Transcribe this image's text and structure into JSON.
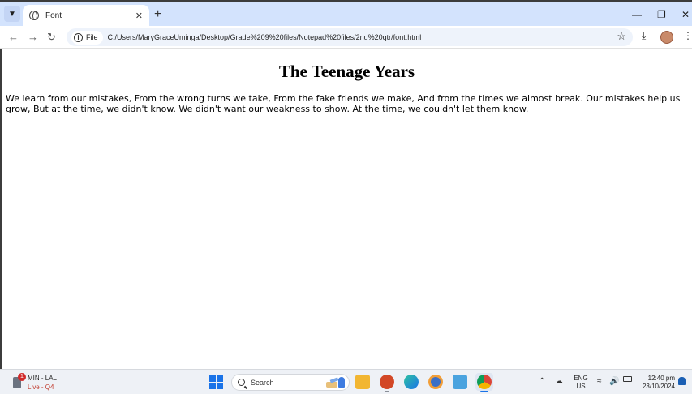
{
  "browser": {
    "tab": {
      "title": "Font"
    },
    "address": {
      "chip_label": "File",
      "url": "C:/Users/MaryGraceUminga/Desktop/Grade%209%20files/Notepad%20files/2nd%20qtr/font.html"
    }
  },
  "page": {
    "heading": "The Teenage Years",
    "paragraph": "We learn from our mistakes, From the wrong turns we take, From the fake friends we make, And from the times we almost break. Our mistakes help us grow, But at the time, we didn't know. We didn't want our weakness to show. At the time, we couldn't let them know."
  },
  "taskbar": {
    "weather": {
      "badge": "1",
      "line1": "MIN - LAL",
      "line2": "Live - Q4"
    },
    "search_label": "Search",
    "language": {
      "line1": "ENG",
      "line2": "US"
    },
    "clock": {
      "time": "12:40 pm",
      "date": "23/10/2024"
    }
  },
  "colors": {
    "tab_strip": "#d3e3fd",
    "omnibox": "#eef3fb",
    "taskbar": "#eef1f6",
    "windows_blue": "#1a73e8",
    "live_red": "#c0392b"
  }
}
